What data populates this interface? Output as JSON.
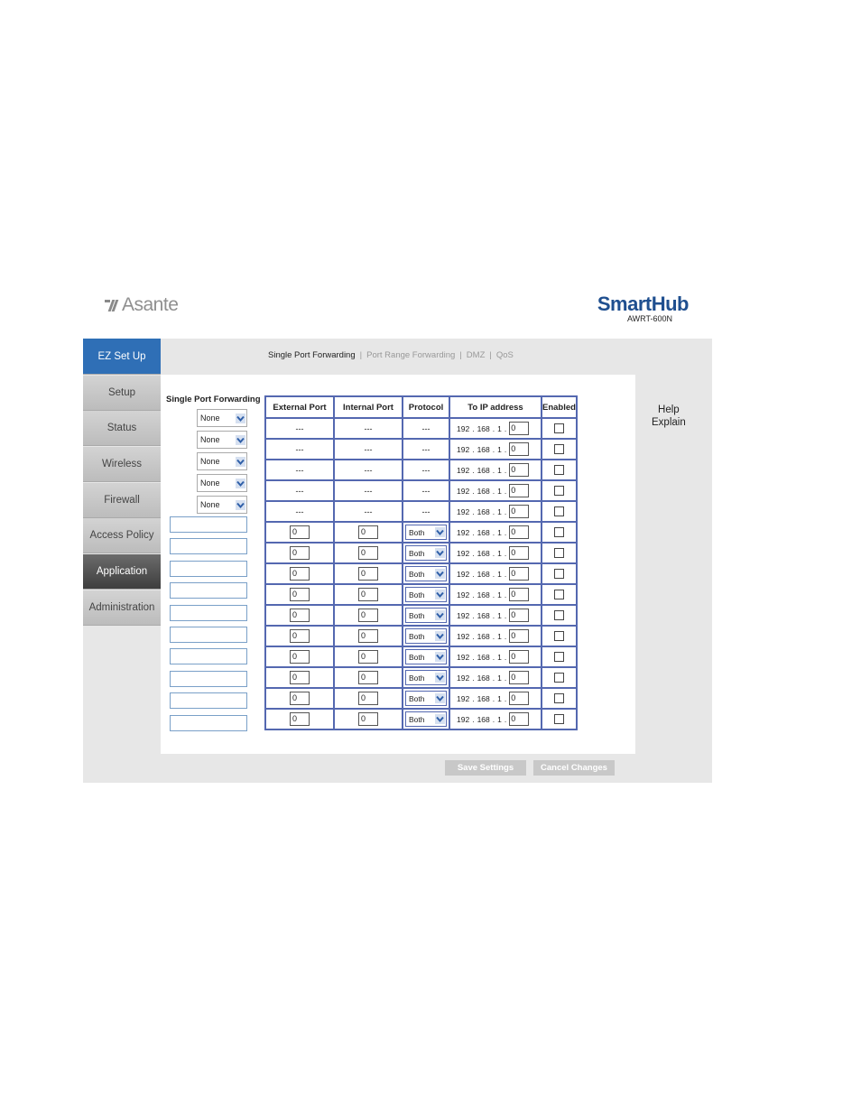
{
  "header": {
    "logo_text": "Asante",
    "brand_name": "SmartHub",
    "brand_model": "AWRT-600N"
  },
  "sidebar": {
    "items": [
      {
        "label": "EZ Set Up",
        "state": "ez"
      },
      {
        "label": "Setup",
        "state": "normal"
      },
      {
        "label": "Status",
        "state": "normal"
      },
      {
        "label": "Wireless",
        "state": "normal"
      },
      {
        "label": "Firewall",
        "state": "normal"
      },
      {
        "label": "Access Policy",
        "state": "normal"
      },
      {
        "label": "Application",
        "state": "active"
      },
      {
        "label": "Administration",
        "state": "normal"
      }
    ]
  },
  "subnav": {
    "items": [
      "Single Port Forwarding",
      "Port Range Forwarding",
      "DMZ",
      "QoS"
    ],
    "current": "Single Port Forwarding"
  },
  "apps": {
    "title": "Single Port Forwarding",
    "selects": [
      "None",
      "None",
      "None",
      "None",
      "None"
    ]
  },
  "table": {
    "headers": [
      "External Port",
      "Internal Port",
      "Protocol",
      "To IP address",
      "Enabled"
    ],
    "ip_prefix": [
      "192",
      "168",
      "1"
    ],
    "preset_rows": [
      {
        "ext": "---",
        "int": "---",
        "proto": "---",
        "ip_last": "0"
      },
      {
        "ext": "---",
        "int": "---",
        "proto": "---",
        "ip_last": "0"
      },
      {
        "ext": "---",
        "int": "---",
        "proto": "---",
        "ip_last": "0"
      },
      {
        "ext": "---",
        "int": "---",
        "proto": "---",
        "ip_last": "0"
      },
      {
        "ext": "---",
        "int": "---",
        "proto": "---",
        "ip_last": "0"
      }
    ],
    "custom_rows": [
      {
        "ext": "0",
        "int": "0",
        "proto": "Both",
        "ip_last": "0"
      },
      {
        "ext": "0",
        "int": "0",
        "proto": "Both",
        "ip_last": "0"
      },
      {
        "ext": "0",
        "int": "0",
        "proto": "Both",
        "ip_last": "0"
      },
      {
        "ext": "0",
        "int": "0",
        "proto": "Both",
        "ip_last": "0"
      },
      {
        "ext": "0",
        "int": "0",
        "proto": "Both",
        "ip_last": "0"
      },
      {
        "ext": "0",
        "int": "0",
        "proto": "Both",
        "ip_last": "0"
      },
      {
        "ext": "0",
        "int": "0",
        "proto": "Both",
        "ip_last": "0"
      },
      {
        "ext": "0",
        "int": "0",
        "proto": "Both",
        "ip_last": "0"
      },
      {
        "ext": "0",
        "int": "0",
        "proto": "Both",
        "ip_last": "0"
      },
      {
        "ext": "0",
        "int": "0",
        "proto": "Both",
        "ip_last": "0"
      }
    ]
  },
  "buttons": {
    "save": "Save Settings",
    "cancel": "Cancel Changes"
  },
  "help": {
    "line1": "Help",
    "line2": "Explain"
  },
  "colors": {
    "accent_blue": "#2f6fb6",
    "table_border": "#5468b0",
    "active_nav": "#4a4a4a"
  }
}
